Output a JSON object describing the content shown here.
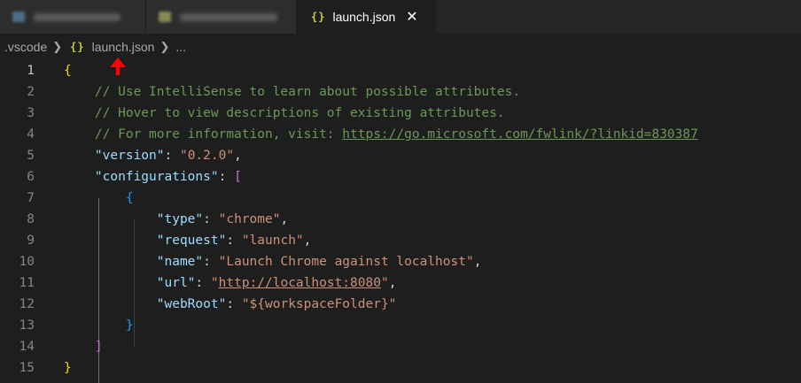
{
  "tabs": [
    {
      "label": "",
      "icon": "file-icon-blurred"
    },
    {
      "label": "",
      "icon": "file-icon-blurred"
    },
    {
      "label": "launch.json",
      "icon": "json-braces-icon",
      "active": true
    }
  ],
  "breadcrumb": {
    "folder": ".vscode",
    "file_icon": "{}",
    "file": "launch.json",
    "more": "..."
  },
  "editor": {
    "current_line": 1,
    "lines": [
      {
        "n": "1",
        "tokens": [
          [
            "b1",
            "{"
          ]
        ]
      },
      {
        "n": "2",
        "tokens": [
          [
            "comment",
            "    // Use IntelliSense to learn about possible attributes."
          ]
        ]
      },
      {
        "n": "3",
        "tokens": [
          [
            "comment",
            "    // Hover to view descriptions of existing attributes."
          ]
        ]
      },
      {
        "n": "4",
        "tokens": [
          [
            "comment",
            "    // For more information, visit: "
          ],
          [
            "comment link",
            "https://go.microsoft.com/fwlink/?linkid=830387"
          ]
        ]
      },
      {
        "n": "5",
        "tokens": [
          [
            "punc",
            "    "
          ],
          [
            "key",
            "\"version\""
          ],
          [
            "punc",
            ": "
          ],
          [
            "str",
            "\"0.2.0\""
          ],
          [
            "punc",
            ","
          ]
        ]
      },
      {
        "n": "6",
        "tokens": [
          [
            "punc",
            "    "
          ],
          [
            "key",
            "\"configurations\""
          ],
          [
            "punc",
            ": "
          ],
          [
            "b2",
            "["
          ]
        ]
      },
      {
        "n": "7",
        "tokens": [
          [
            "punc",
            "        "
          ],
          [
            "b3",
            "{"
          ]
        ]
      },
      {
        "n": "8",
        "tokens": [
          [
            "punc",
            "            "
          ],
          [
            "key",
            "\"type\""
          ],
          [
            "punc",
            ": "
          ],
          [
            "str",
            "\"chrome\""
          ],
          [
            "punc",
            ","
          ]
        ]
      },
      {
        "n": "9",
        "tokens": [
          [
            "punc",
            "            "
          ],
          [
            "key",
            "\"request\""
          ],
          [
            "punc",
            ": "
          ],
          [
            "str",
            "\"launch\""
          ],
          [
            "punc",
            ","
          ]
        ]
      },
      {
        "n": "10",
        "tokens": [
          [
            "punc",
            "            "
          ],
          [
            "key",
            "\"name\""
          ],
          [
            "punc",
            ": "
          ],
          [
            "str",
            "\"Launch Chrome against localhost\""
          ],
          [
            "punc",
            ","
          ]
        ]
      },
      {
        "n": "11",
        "tokens": [
          [
            "punc",
            "            "
          ],
          [
            "key",
            "\"url\""
          ],
          [
            "punc",
            ": "
          ],
          [
            "str",
            "\""
          ],
          [
            "str link",
            "http://localhost:8080"
          ],
          [
            "str",
            "\""
          ],
          [
            "punc",
            ","
          ]
        ]
      },
      {
        "n": "12",
        "tokens": [
          [
            "punc",
            "            "
          ],
          [
            "key",
            "\"webRoot\""
          ],
          [
            "punc",
            ": "
          ],
          [
            "str",
            "\"${workspaceFolder}\""
          ]
        ]
      },
      {
        "n": "13",
        "tokens": [
          [
            "punc",
            "        "
          ],
          [
            "b3",
            "}"
          ]
        ]
      },
      {
        "n": "14",
        "tokens": [
          [
            "punc",
            "    "
          ],
          [
            "b2",
            "]"
          ]
        ]
      },
      {
        "n": "15",
        "tokens": [
          [
            "b1",
            "}"
          ]
        ]
      }
    ]
  },
  "colors": {
    "editor_bg": "#1e1e1e",
    "comment": "#6a9955",
    "key": "#9cdcfe",
    "string": "#ce9178",
    "bracket_level1": "#ffd700",
    "bracket_level2": "#da70d6",
    "bracket_level3": "#179fff",
    "annotation_arrow": "#ff0000"
  }
}
